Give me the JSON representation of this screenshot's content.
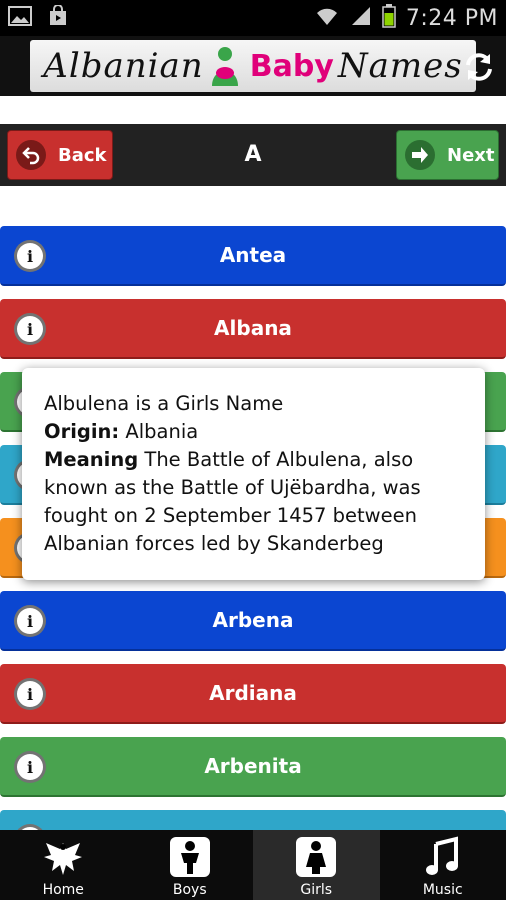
{
  "status_bar": {
    "time": "7:24 PM"
  },
  "banner": {
    "title_left": "Albanian",
    "title_baby": "Baby",
    "title_right": "Names"
  },
  "toolbar": {
    "back_label": "Back",
    "current_letter": "A",
    "next_label": "Next"
  },
  "names": [
    {
      "label": "Antea",
      "color": "blue"
    },
    {
      "label": "Albana",
      "color": "red"
    },
    {
      "label": "",
      "color": "green"
    },
    {
      "label": "",
      "color": "teal"
    },
    {
      "label": "",
      "color": "orange"
    },
    {
      "label": "Arbena",
      "color": "blue"
    },
    {
      "label": "Ardiana",
      "color": "red"
    },
    {
      "label": "Arbenita",
      "color": "green"
    },
    {
      "label": "",
      "color": "teal"
    }
  ],
  "popup": {
    "line1": "Albulena is a Girls Name",
    "origin_label": "Origin:",
    "origin_value": " Albania",
    "meaning_label": "Meaning",
    "meaning_value": " The Battle of Albulena, also known as the Battle of Ujëbardha, was fought on 2 September 1457 between Albanian forces led by Skanderbeg"
  },
  "tabs": [
    {
      "label": "Home",
      "icon": "eagle-icon"
    },
    {
      "label": "Boys",
      "icon": "boy-icon"
    },
    {
      "label": "Girls",
      "icon": "girl-icon",
      "active": true
    },
    {
      "label": "Music",
      "icon": "music-note-icon"
    }
  ],
  "colors": {
    "blue": "#0b46d1",
    "red": "#c8302e",
    "green": "#49a34f",
    "teal": "#2fa6c9",
    "orange": "#f5901e"
  }
}
